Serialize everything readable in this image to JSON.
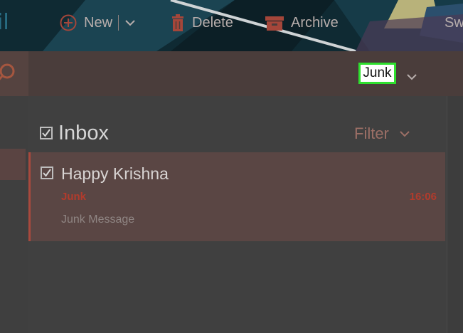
{
  "banner": {
    "title": "il"
  },
  "toolbar": {
    "new_label": "New",
    "delete_label": "Delete",
    "archive_label": "Archive",
    "junk_label": "Junk",
    "sweep_label": "Sw"
  },
  "list": {
    "title": "Inbox",
    "filter_label": "Filter"
  },
  "message": {
    "sender": "Happy Krishna",
    "folder": "Junk",
    "time": "16:06",
    "preview": "Junk Message"
  },
  "colors": {
    "accent": "#b23b2c",
    "highlight": "#2ee02e"
  }
}
